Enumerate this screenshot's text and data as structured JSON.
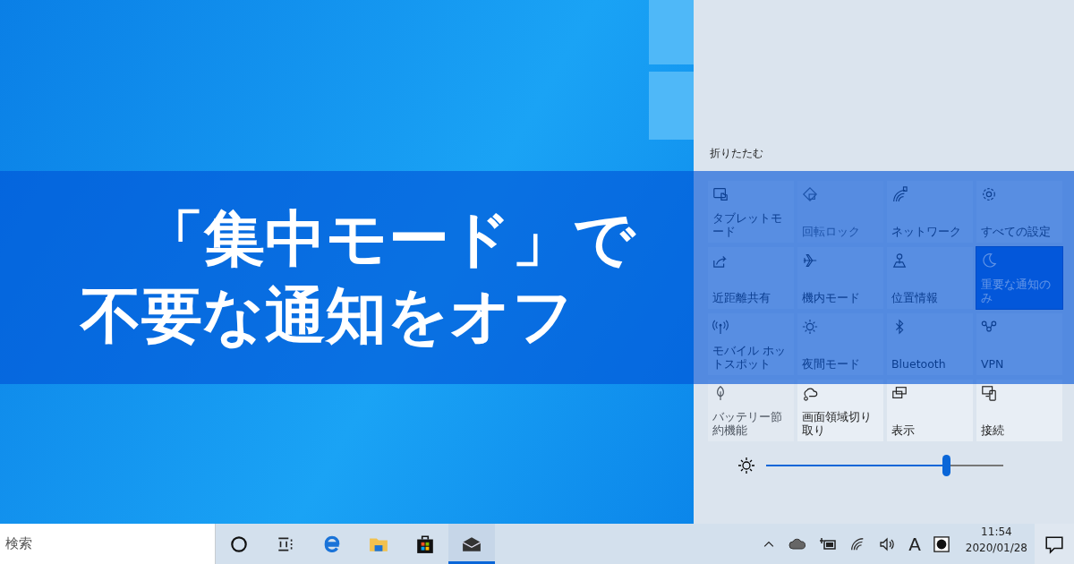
{
  "headline": [
    "「集中モード」で",
    "不要な通知をオフ"
  ],
  "action_center": {
    "collapse": "折りたたむ",
    "tiles": [
      {
        "label": "タブレットモード",
        "on": false,
        "disabled": false
      },
      {
        "label": "回転ロック",
        "on": false,
        "disabled": true
      },
      {
        "label": "ネットワーク",
        "on": false,
        "disabled": false
      },
      {
        "label": "すべての設定",
        "on": false,
        "disabled": false
      },
      {
        "label": "近距離共有",
        "on": false,
        "disabled": false
      },
      {
        "label": "機内モード",
        "on": false,
        "disabled": false
      },
      {
        "label": "位置情報",
        "on": false,
        "disabled": false
      },
      {
        "label": "重要な通知のみ",
        "on": true,
        "disabled": false
      },
      {
        "label": "モバイル ホットスポット",
        "on": false,
        "disabled": false
      },
      {
        "label": "夜間モード",
        "on": false,
        "disabled": false
      },
      {
        "label": "Bluetooth",
        "on": false,
        "disabled": false
      },
      {
        "label": "VPN",
        "on": false,
        "disabled": false
      },
      {
        "label": "バッテリー節約機能",
        "on": false,
        "disabled": true
      },
      {
        "label": "画面領域切り取り",
        "on": false,
        "disabled": false
      },
      {
        "label": "表示",
        "on": false,
        "disabled": false
      },
      {
        "label": "接続",
        "on": false,
        "disabled": false
      }
    ],
    "brightness": {
      "level": 0.76
    }
  },
  "taskbar": {
    "search": {
      "placeholder": "検索"
    },
    "apps": [
      {
        "selected": false
      },
      {
        "selected": false
      },
      {
        "selected": false
      },
      {
        "selected": false
      },
      {
        "selected": false
      },
      {
        "selected": true
      }
    ],
    "ime": "A",
    "time": "11:54",
    "date": "2020/01/28"
  }
}
